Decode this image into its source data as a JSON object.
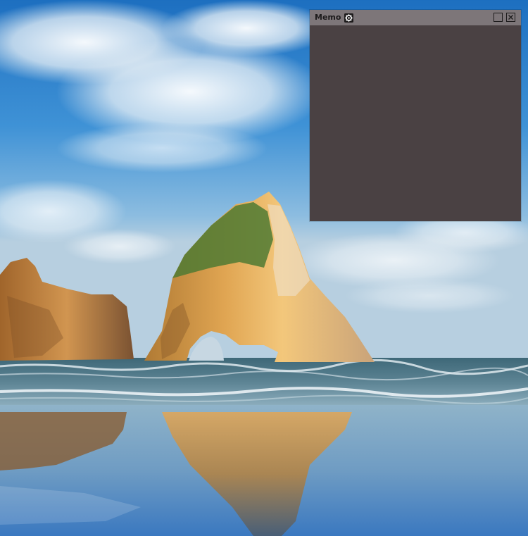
{
  "desktop": {
    "wallpaper": "beach-rock-arch-wallpaper"
  },
  "memo": {
    "title": "Memo",
    "settings_icon": "gear-icon",
    "maximize_icon": "square-icon",
    "close_icon": "close-icon",
    "content": "",
    "colors": {
      "titlebar": "#7d7679",
      "body": "#4a4143"
    }
  }
}
